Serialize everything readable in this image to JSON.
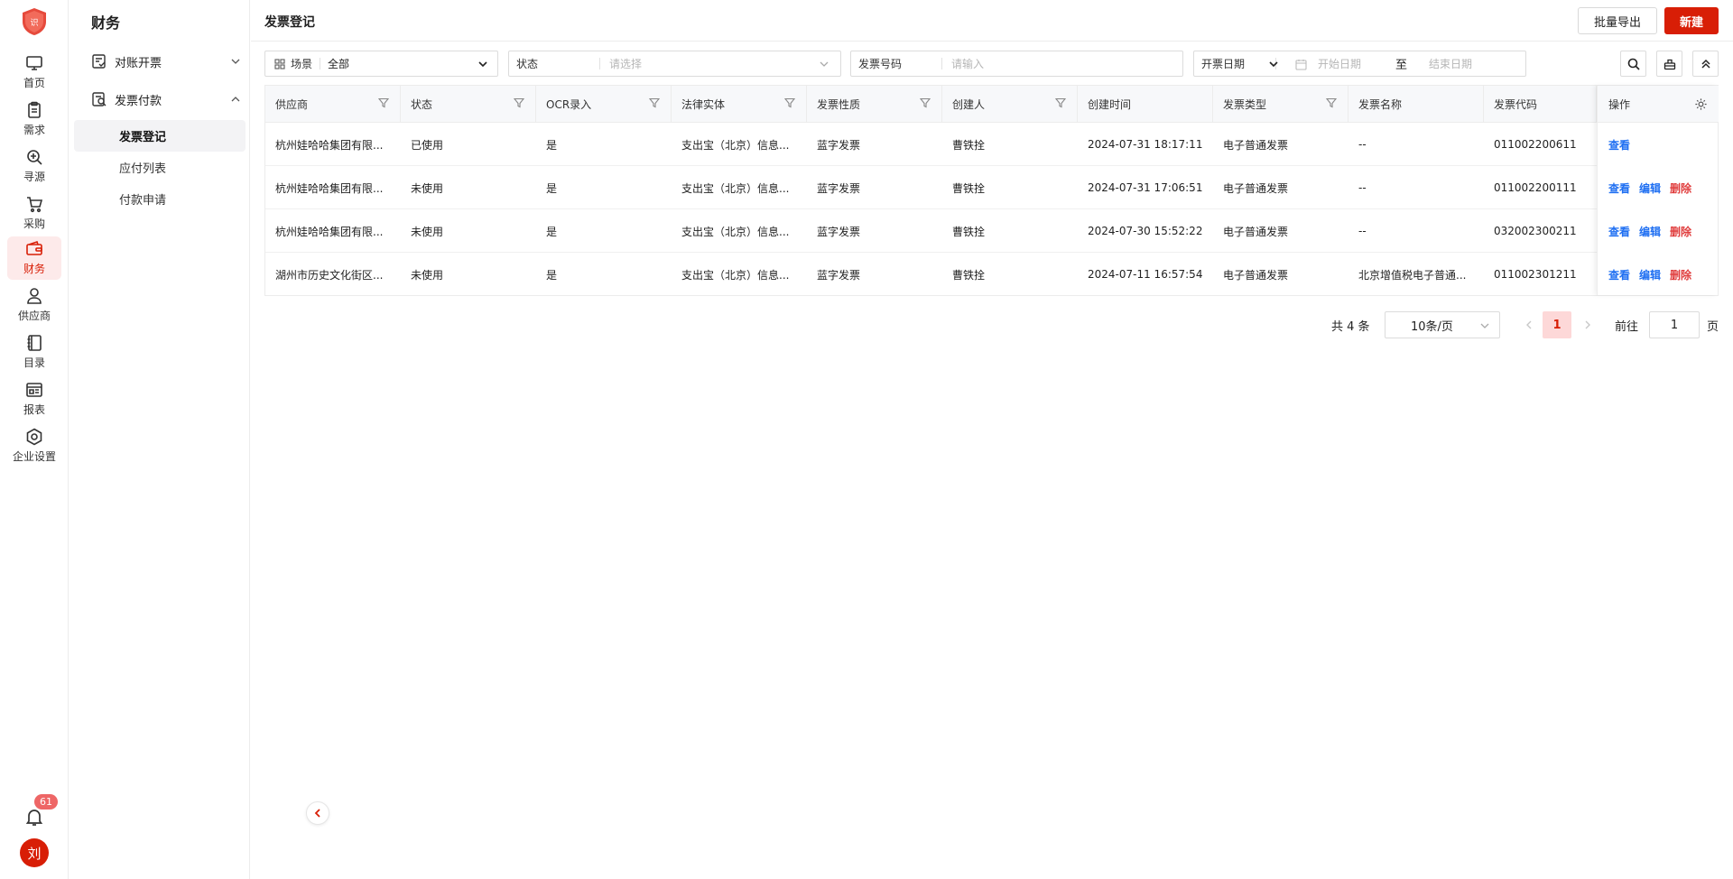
{
  "colors": {
    "accent": "#d81e06",
    "link": "#1f6ff2",
    "danger": "#e03e3e"
  },
  "rail": {
    "items": [
      {
        "label": "首页",
        "icon": "monitor-icon"
      },
      {
        "label": "需求",
        "icon": "clipboard-icon"
      },
      {
        "label": "寻源",
        "icon": "search-plus-icon"
      },
      {
        "label": "采购",
        "icon": "cart-icon"
      },
      {
        "label": "财务",
        "icon": "wallet-icon",
        "active": true
      },
      {
        "label": "供应商",
        "icon": "user-icon"
      },
      {
        "label": "目录",
        "icon": "book-icon"
      },
      {
        "label": "报表",
        "icon": "report-icon"
      },
      {
        "label": "企业设置",
        "icon": "settings-hex-icon"
      }
    ],
    "notification_count": "61",
    "avatar_text": "刘"
  },
  "subnav": {
    "title": "财务",
    "groups": [
      {
        "label": "对账开票",
        "expanded": false
      },
      {
        "label": "发票付款",
        "expanded": true,
        "items": [
          "发票登记",
          "应付列表",
          "付款申请"
        ]
      }
    ]
  },
  "page": {
    "title": "发票登记",
    "export_label": "批量导出",
    "new_label": "新建"
  },
  "filters": {
    "scene_label": "场景",
    "scene_value": "全部",
    "status_label": "状态",
    "status_placeholder": "请选择",
    "invoice_no_label": "发票号码",
    "invoice_no_placeholder": "请输入",
    "date_type": "开票日期",
    "start_placeholder": "开始日期",
    "range_sep": "至",
    "end_placeholder": "结束日期"
  },
  "table": {
    "headers": [
      "供应商",
      "状态",
      "OCR录入",
      "法律实体",
      "发票性质",
      "创建人",
      "创建时间",
      "发票类型",
      "发票名称",
      "发票代码"
    ],
    "op_header": "操作",
    "rows": [
      {
        "cells": [
          "杭州娃哈哈集团有限...",
          "已使用",
          "是",
          "支出宝（北京）信息...",
          "蓝字发票",
          "曹铁拴",
          "2024-07-31 18:17:11",
          "电子普通发票",
          "--",
          "011002200611"
        ],
        "actions": [
          "查看"
        ]
      },
      {
        "cells": [
          "杭州娃哈哈集团有限...",
          "未使用",
          "是",
          "支出宝（北京）信息...",
          "蓝字发票",
          "曹铁拴",
          "2024-07-31 17:06:51",
          "电子普通发票",
          "--",
          "011002200111"
        ],
        "actions": [
          "查看",
          "编辑",
          "删除"
        ]
      },
      {
        "cells": [
          "杭州娃哈哈集团有限...",
          "未使用",
          "是",
          "支出宝（北京）信息...",
          "蓝字发票",
          "曹铁拴",
          "2024-07-30 15:52:22",
          "电子普通发票",
          "--",
          "032002300211"
        ],
        "actions": [
          "查看",
          "编辑",
          "删除"
        ]
      },
      {
        "cells": [
          "湖州市历史文化街区...",
          "未使用",
          "是",
          "支出宝（北京）信息...",
          "蓝字发票",
          "曹铁拴",
          "2024-07-11 16:57:54",
          "电子普通发票",
          "北京增值税电子普通...",
          "011002301211"
        ],
        "actions": [
          "查看",
          "编辑",
          "删除"
        ]
      }
    ]
  },
  "pager": {
    "total": "共 4 条",
    "page_size": "10条/页",
    "current": "1",
    "goto_label": "前往",
    "goto_value": "1",
    "page_suffix": "页"
  }
}
